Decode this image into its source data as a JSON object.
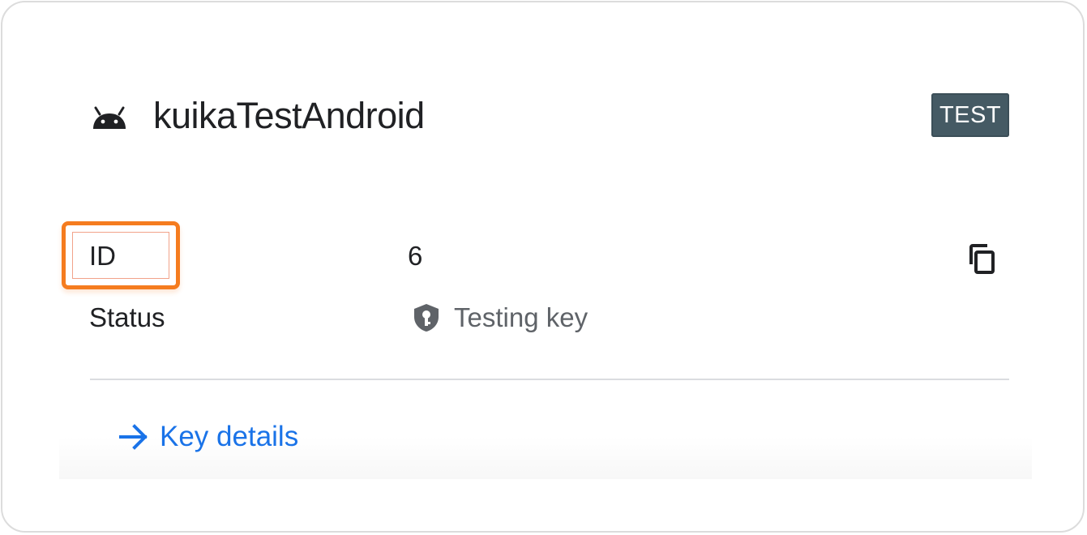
{
  "card": {
    "app_name": "kuikaTestAndroid",
    "platform_icon": "android-icon",
    "environment_badge": "TEST"
  },
  "details": {
    "rows": [
      {
        "label": "ID",
        "value": "6",
        "action_icon": "copy-icon",
        "highlighted": true
      },
      {
        "label": "Status",
        "value": "Testing key",
        "value_icon": "shield-key-icon"
      }
    ]
  },
  "footer": {
    "link_label": "Key details",
    "link_icon": "arrow-right-icon"
  },
  "colors": {
    "badge_bg": "#455a64",
    "link": "#1a73e8",
    "highlight": "#f57c1f",
    "text": "#202124",
    "muted_text": "#5f6368"
  }
}
